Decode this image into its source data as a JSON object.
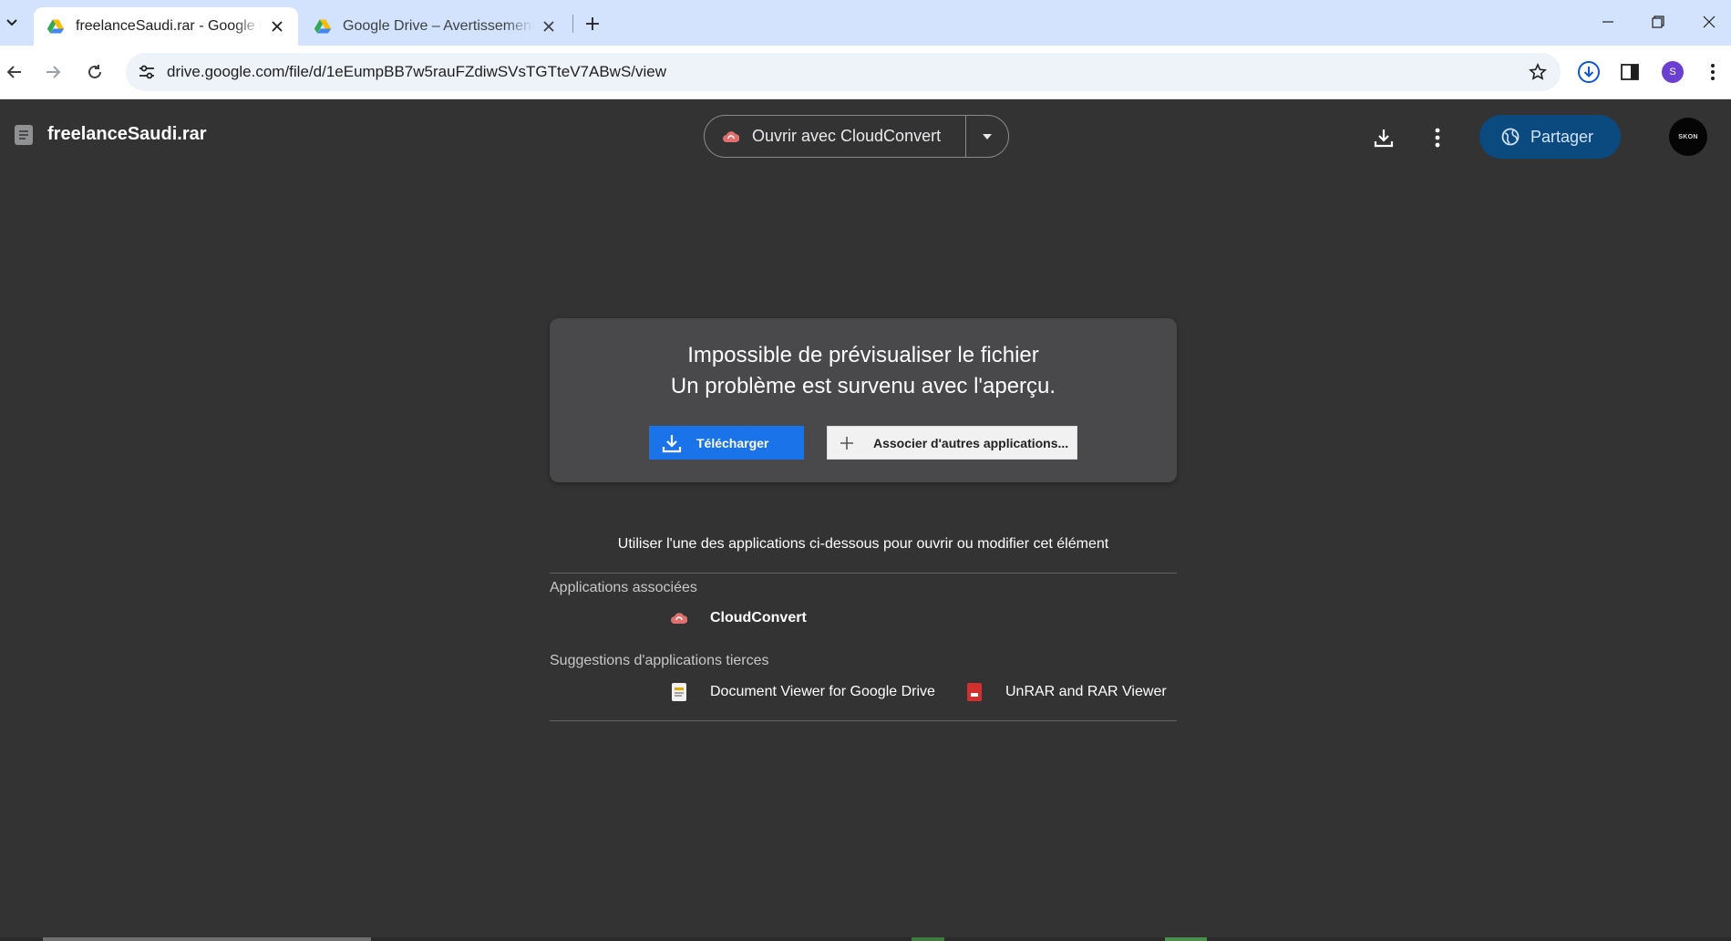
{
  "browser": {
    "tabs": [
      {
        "title": "freelanceSaudi.rar - Google Drive",
        "active": true
      },
      {
        "title": "Google Drive – Avertissement de",
        "active": false
      }
    ],
    "url": "drive.google.com/file/d/1eEumpBB7w5rauFZdiwSVsTGTteV7ABwS/view",
    "profile_initial": "S"
  },
  "viewer": {
    "file_name": "freelanceSaudi.rar",
    "open_with_label": "Ouvrir avec CloudConvert",
    "share_label": "Partager",
    "account_label": "SKON"
  },
  "error": {
    "title": "Impossible de prévisualiser le fichier",
    "subtitle": "Un problème est survenu avec l'aperçu.",
    "download_label": "Télécharger",
    "associate_label": "Associer d'autres applications..."
  },
  "apps": {
    "intro": "Utiliser l'une des applications ci-dessous pour ouvrir ou modifier cet élément",
    "associated_heading": "Applications associées",
    "associated": [
      {
        "name": "CloudConvert"
      }
    ],
    "suggestions_heading": "Suggestions d'applications tierces",
    "suggestions": [
      {
        "name": "Document Viewer for Google Drive"
      },
      {
        "name": "UnRAR and RAR Viewer"
      }
    ]
  },
  "colors": {
    "viewer_bg": "#333333",
    "card_bg": "#49494b",
    "download_blue": "#1a73e8",
    "share_bg": "#0a4a7f",
    "tabbar_bg": "#d3e3fd"
  }
}
